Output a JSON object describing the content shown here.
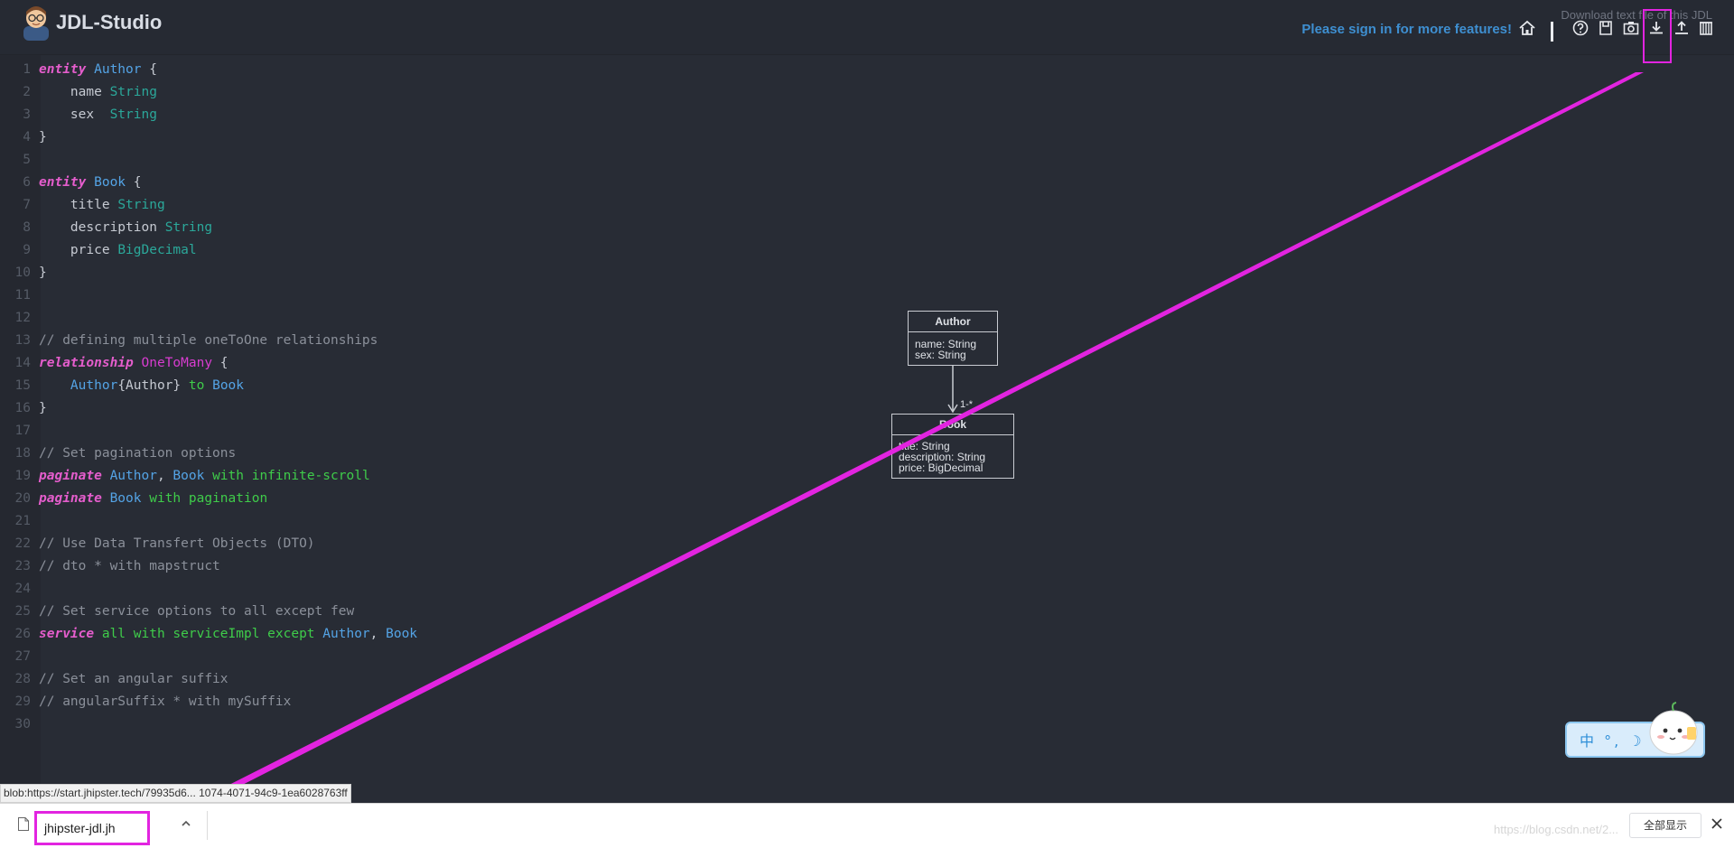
{
  "header": {
    "app_title": "JDL-Studio",
    "sign_in_text": "Please sign in for more features!",
    "tooltip_text": "Download text file of this JDL",
    "toolbar_icons": [
      "home-icon",
      "help-icon",
      "save-icon",
      "camera-icon",
      "download-icon",
      "upload-icon",
      "delete-icon"
    ]
  },
  "editor": {
    "lines": [
      {
        "n": "1"
      },
      {
        "n": "2"
      },
      {
        "n": "3"
      },
      {
        "n": "4"
      },
      {
        "n": "5"
      },
      {
        "n": "6"
      },
      {
        "n": "7"
      },
      {
        "n": "8"
      },
      {
        "n": "9"
      },
      {
        "n": "10"
      },
      {
        "n": "11"
      },
      {
        "n": "12"
      },
      {
        "n": "13"
      },
      {
        "n": "14"
      },
      {
        "n": "15"
      },
      {
        "n": "16"
      },
      {
        "n": "17"
      },
      {
        "n": "18"
      },
      {
        "n": "19"
      },
      {
        "n": "20"
      },
      {
        "n": "21"
      },
      {
        "n": "22"
      },
      {
        "n": "23"
      },
      {
        "n": "24"
      },
      {
        "n": "25"
      },
      {
        "n": "26"
      },
      {
        "n": "27"
      },
      {
        "n": "28"
      },
      {
        "n": "29"
      },
      {
        "n": "30"
      }
    ],
    "tokens": {
      "l1": [
        "entity",
        " Author",
        " {"
      ],
      "l2": [
        "    name ",
        "String"
      ],
      "l3": [
        "    sex  ",
        "String"
      ],
      "l4": [
        "}"
      ],
      "l6": [
        "entity",
        " Book",
        " {"
      ],
      "l7": [
        "    title ",
        "String"
      ],
      "l8": [
        "    description ",
        "String"
      ],
      "l9": [
        "    price ",
        "BigDecimal"
      ],
      "l10": [
        "}"
      ],
      "l13": [
        "// defining multiple oneToOne relationships"
      ],
      "l14": [
        "relationship",
        " OneToMany",
        " {"
      ],
      "l15": [
        "    ",
        "Author",
        "{Author}",
        " to",
        " Book"
      ],
      "l16": [
        "}"
      ],
      "l18": [
        "// Set pagination options"
      ],
      "l19": [
        "paginate",
        " Author",
        ",",
        " Book",
        " with infinite-scroll"
      ],
      "l20": [
        "paginate",
        " Book",
        " with pagination"
      ],
      "l22": [
        "// Use Data Transfert Objects (DTO)"
      ],
      "l23": [
        "// dto * with mapstruct"
      ],
      "l25": [
        "// Set service options to all except few"
      ],
      "l26": [
        "service",
        " all with serviceImpl except",
        " Author",
        ",",
        " Book"
      ],
      "l28": [
        "// Set an angular suffix"
      ],
      "l29": [
        "// angularSuffix * with mySuffix"
      ]
    }
  },
  "diagram": {
    "author": {
      "title": "Author",
      "fields": [
        "name: String",
        "sex: String"
      ]
    },
    "book": {
      "title": "Book",
      "fields": [
        "title: String",
        "description: String",
        "price: BigDecimal"
      ]
    },
    "multiplicity": "1-*"
  },
  "status_url": "blob:https://start.jhipster.tech/79935d6... 1074-4071-94c9-1ea6028763ff",
  "download_bar": {
    "file_name": "jhipster-jdl.jh",
    "show_all_label": "全部显示",
    "watermark": "https://blog.csdn.net/2..."
  },
  "ime": {
    "chars": "中 °, ☽ 👕"
  },
  "colors": {
    "accent_magenta": "#e224e0",
    "link_blue": "#3e8fd1",
    "editor_bg": "#282c35"
  }
}
